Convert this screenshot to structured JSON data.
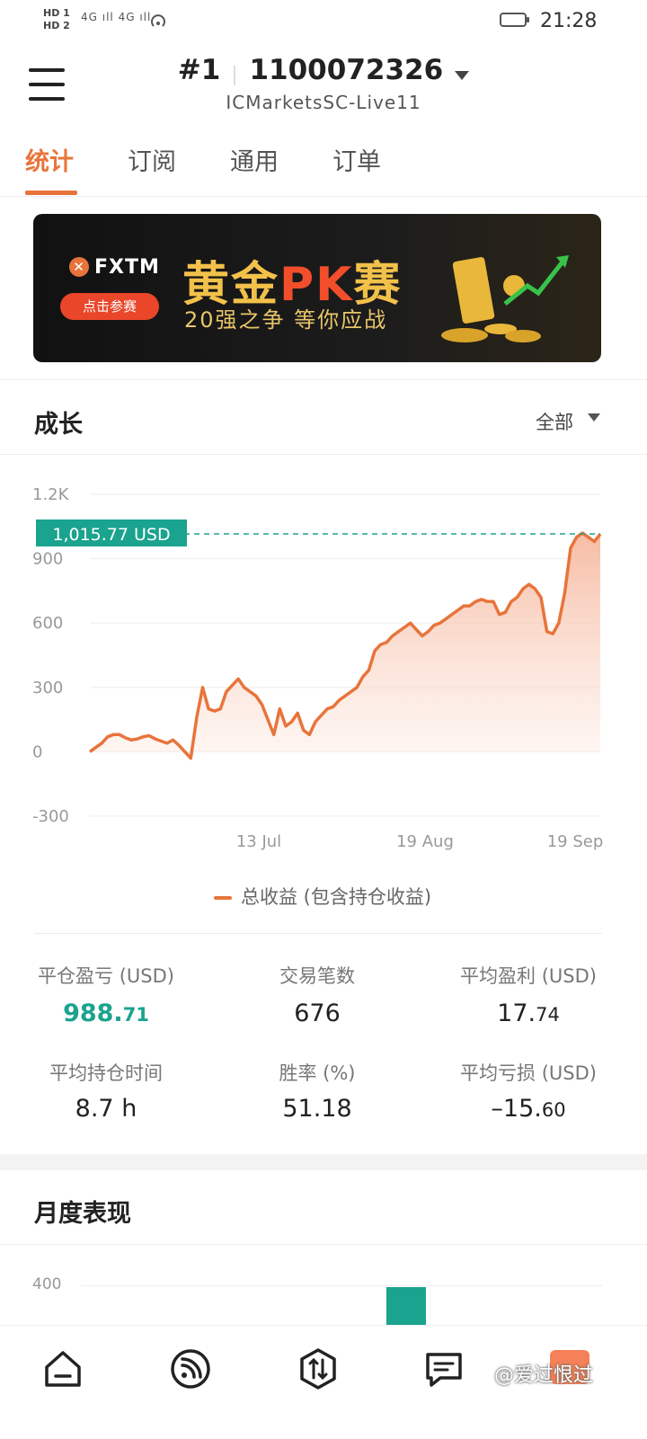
{
  "status_bar": {
    "sim1": "HD 1",
    "sim2": "HD 2",
    "signal": "4G ıll 4G ıll",
    "time": "21:28"
  },
  "header": {
    "account_number": "#1",
    "account_id": "1100072326",
    "server": "ICMarketsSC-Live11"
  },
  "tabs": [
    {
      "label": "统计",
      "active": true
    },
    {
      "label": "订阅",
      "active": false
    },
    {
      "label": "通用",
      "active": false
    },
    {
      "label": "订单",
      "active": false
    }
  ],
  "banner": {
    "brand": "FXTM",
    "button": "点击参赛",
    "title_left": "黄金",
    "title_pk": "PK",
    "title_right": "赛",
    "subtitle": "20强之争  等你应战"
  },
  "growth": {
    "title": "成长",
    "filter": "全部",
    "legend": "总收益 (包含持仓收益)",
    "current_value_label": "1,015.77 USD"
  },
  "chart_data": {
    "type": "area",
    "ylim": [
      -300,
      1200
    ],
    "yticks": [
      "1.2K",
      "900",
      "600",
      "300",
      "0",
      "-300"
    ],
    "xticks": [
      "13 Jul",
      "19 Aug",
      "19 Sep"
    ],
    "current_value": 1015.77,
    "series": [
      {
        "name": "总收益 (包含持仓收益)",
        "values": [
          0,
          20,
          40,
          70,
          80,
          80,
          65,
          55,
          60,
          70,
          75,
          60,
          50,
          40,
          55,
          30,
          0,
          -30,
          160,
          300,
          200,
          190,
          200,
          280,
          310,
          340,
          300,
          280,
          260,
          220,
          150,
          80,
          200,
          120,
          140,
          180,
          100,
          80,
          140,
          170,
          200,
          210,
          240,
          260,
          280,
          300,
          350,
          380,
          470,
          500,
          510,
          540,
          560,
          580,
          600,
          570,
          540,
          560,
          590,
          600,
          620,
          640,
          660,
          680,
          680,
          700,
          710,
          700,
          700,
          640,
          650,
          700,
          720,
          760,
          780,
          760,
          720,
          560,
          550,
          600,
          740,
          950,
          1000,
          1020,
          1000,
          980,
          1015
        ]
      }
    ],
    "colors": {
      "line": "#e8743b",
      "fill_top": "#f5b59a",
      "marker": "#1aa38e"
    }
  },
  "stats": [
    {
      "label": "平仓盈亏 (USD)",
      "value_main": "988.",
      "value_small": "71",
      "highlight": true
    },
    {
      "label": "交易笔数",
      "value_main": "676",
      "value_small": "",
      "highlight": false
    },
    {
      "label": "平均盈利 (USD)",
      "value_main": "17.",
      "value_small": "74",
      "highlight": false
    },
    {
      "label": "平均持仓时间",
      "value_main": "8.7 h",
      "value_small": "",
      "highlight": false
    },
    {
      "label": "胜率 (%)",
      "value_main": "51.18",
      "value_small": "",
      "highlight": false
    },
    {
      "label": "平均亏损 (USD)",
      "value_main": "–15.",
      "value_small": "60",
      "highlight": false
    }
  ],
  "monthly": {
    "title": "月度表现",
    "ytick": "400"
  },
  "bottom_nav": {
    "items": [
      "home-icon",
      "feed-icon",
      "trade-icon",
      "news-icon"
    ],
    "watermark": "@爱过恨过"
  }
}
